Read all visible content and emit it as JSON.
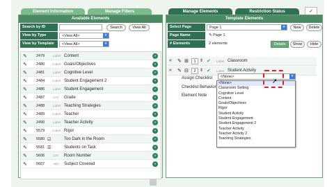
{
  "tabs": [
    {
      "label": "Element Information"
    },
    {
      "label": "Manage Filters"
    },
    {
      "label": "Manage Elements"
    },
    {
      "label": "Restriction Status"
    }
  ],
  "available": {
    "title": "Available Elements",
    "search_label": "Search by ID",
    "search_button": "Search",
    "view_all_button": "View All",
    "view_by_type_label": "View by Type",
    "view_by_type_value": "<View All>",
    "view_by_template_label": "View by Template",
    "view_by_template_value": "<View All>",
    "rows": [
      {
        "id": "2479",
        "type": "Label",
        "name": "Content"
      },
      {
        "id": "2480",
        "type": "Label",
        "name": "Goals/Objectives"
      },
      {
        "id": "2481",
        "type": "Label",
        "name": "Cognitive Level"
      },
      {
        "id": "2484",
        "type": "Label",
        "name": "Student Engagement 2"
      },
      {
        "id": "2486",
        "type": "Label",
        "name": "Student Engagement"
      },
      {
        "id": "2487",
        "type": "VAC",
        "name": "Grade"
      },
      {
        "id": "2488",
        "type": "Label",
        "name": "Teaching Strategies"
      },
      {
        "id": "2489",
        "type": "Label",
        "name": "Teacher"
      },
      {
        "id": "2490",
        "type": "Label",
        "name": "Teacher Activity"
      },
      {
        "id": "5579",
        "type": "Label",
        "name": "Rigor"
      },
      {
        "id": "5580",
        "type": "",
        "name": "Too Dark in the Room"
      },
      {
        "id": "5581",
        "type": "",
        "name": "Students on Task"
      },
      {
        "id": "5606",
        "type": "123",
        "name": "Room Number"
      },
      {
        "id": "5607",
        "type": "ABC",
        "name": "Subject Covered"
      }
    ]
  },
  "template": {
    "title": "Template Elements",
    "select_page_label": "Select Page",
    "select_page_value": "Page 1",
    "new_button": "New",
    "delete_button": "Delete",
    "page_name_label": "Page Name",
    "page_name_value": "Page 1",
    "elements_label": "# Elements",
    "elements_value": "2 elements",
    "details_label": "Details",
    "show_button": "Show",
    "hide_button": "Hide",
    "rows": [
      {
        "order": "1",
        "type": "Label",
        "name": "Classroom"
      },
      {
        "order": "2",
        "type": "Label",
        "name": "Student Activity"
      }
    ],
    "assign_checklist_label": "Assign Checklist",
    "checklist_behavior_label": "Checklist Behavior",
    "element_note_label": "Element Note",
    "dropdown_value": "<None>",
    "dropdown_options": [
      "<None>",
      "Classroom Setting",
      "Cognitive Level",
      "Content",
      "Goals/Objectives",
      "Rigor",
      "Student Activity",
      "Student Engagement",
      "Student Engagement 2",
      "Teacher Activity",
      "Teacher Activity 2",
      "Teaching Strategies"
    ]
  }
}
